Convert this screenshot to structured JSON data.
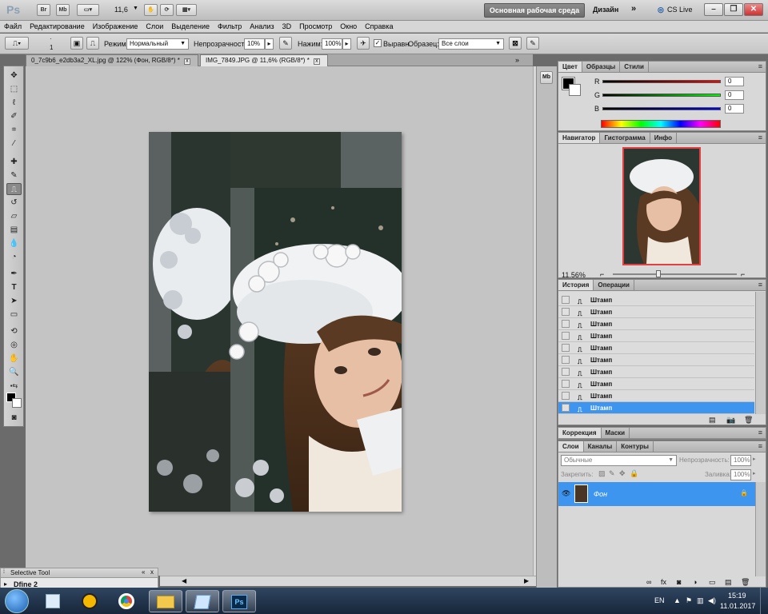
{
  "app": {
    "logo": "Ps",
    "bridge_label": "Br",
    "minibridge_label": "Mb",
    "zoom_value": "11,6",
    "workspace_label": "Основная рабочая среда",
    "design_label": "Дизайн",
    "more_label": "»",
    "cslive_label": "CS Live"
  },
  "menu": [
    "Файл",
    "Редактирование",
    "Изображение",
    "Слои",
    "Выделение",
    "Фильтр",
    "Анализ",
    "3D",
    "Просмотр",
    "Окно",
    "Справка"
  ],
  "options": {
    "brush_size": "1",
    "mode_label": "Режим:",
    "mode_value": "Нормальный",
    "opacity_label": "Непрозрачность:",
    "opacity_value": "10%",
    "flow_label": "Нажим:",
    "flow_value": "100%",
    "aligned_label": "Выравн.",
    "sample_label": "Образец:",
    "sample_value": "Все слои"
  },
  "tabs": [
    {
      "title": "0_7c9b6_e2db3a2_XL.jpg @ 122% (Фон, RGB/8*) *",
      "active": false
    },
    {
      "title": "IMG_7849.JPG @ 11,6% (RGB/8*) *",
      "active": true
    }
  ],
  "color_panel": {
    "tabs": [
      "Цвет",
      "Образцы",
      "Стили"
    ],
    "channels": [
      {
        "label": "R",
        "value": "0",
        "color": "#ff0000"
      },
      {
        "label": "G",
        "value": "0",
        "color": "#00ff00"
      },
      {
        "label": "B",
        "value": "0",
        "color": "#0000ff"
      }
    ]
  },
  "navigator_panel": {
    "tabs": [
      "Навигатор",
      "Гистограмма",
      "Инфо"
    ],
    "zoom": "11.56%"
  },
  "history_panel": {
    "tabs": [
      "История",
      "Операции"
    ],
    "items": [
      "Штамп",
      "Штамп",
      "Штамп",
      "Штамп",
      "Штамп",
      "Штамп",
      "Штамп",
      "Штамп",
      "Штамп",
      "Штамп"
    ],
    "active_index": 9
  },
  "adjust_panel": {
    "tabs": [
      "Коррекция",
      "Маски"
    ]
  },
  "layers_panel": {
    "tabs": [
      "Слои",
      "Каналы",
      "Контуры"
    ],
    "blend_mode": "Обычные",
    "opacity_label": "Непрозрачность:",
    "opacity_value": "100%",
    "lock_label": "Закрепить:",
    "fill_label": "Заливка:",
    "fill_value": "100%",
    "layers": [
      {
        "name": "Фон",
        "selected": true
      }
    ]
  },
  "selective_tool": {
    "title": "Selective Tool",
    "item": "Dfine 2"
  },
  "taskbar": {
    "lang": "EN",
    "time": "15:19",
    "date": "11.01.2017"
  },
  "colors": {
    "accent": "#3d95f0",
    "foreground": "#000000",
    "background": "#ffffff"
  }
}
